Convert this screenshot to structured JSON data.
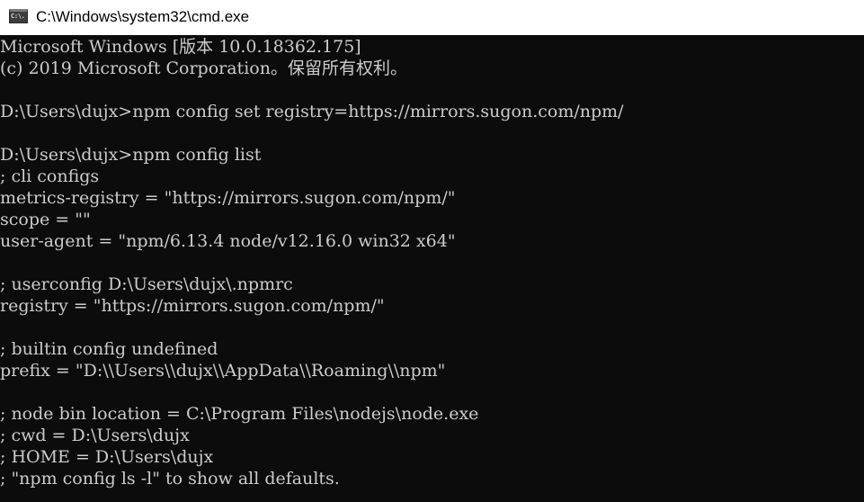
{
  "window": {
    "title": "C:\\Windows\\system32\\cmd.exe",
    "icon_name": "cmd-console-icon",
    "icon_label": "C:\\."
  },
  "console": {
    "foreground": "#cccccc",
    "background": "#0c0c0c",
    "lines": [
      "Microsoft Windows [版本 10.0.18362.175]",
      "(c) 2019 Microsoft Corporation。保留所有权利。",
      "",
      "D:\\Users\\dujx>npm config set registry=https://mirrors.sugon.com/npm/",
      "",
      "D:\\Users\\dujx>npm config list",
      "; cli configs",
      "metrics-registry = \"https://mirrors.sugon.com/npm/\"",
      "scope = \"\"",
      "user-agent = \"npm/6.13.4 node/v12.16.0 win32 x64\"",
      "",
      "; userconfig D:\\Users\\dujx\\.npmrc",
      "registry = \"https://mirrors.sugon.com/npm/\"",
      "",
      "; builtin config undefined",
      "prefix = \"D:\\\\Users\\\\dujx\\\\AppData\\\\Roaming\\\\npm\"",
      "",
      "; node bin location = C:\\Program Files\\nodejs\\node.exe",
      "; cwd = D:\\Users\\dujx",
      "; HOME = D:\\Users\\dujx",
      "; \"npm config ls -l\" to show all defaults."
    ]
  }
}
